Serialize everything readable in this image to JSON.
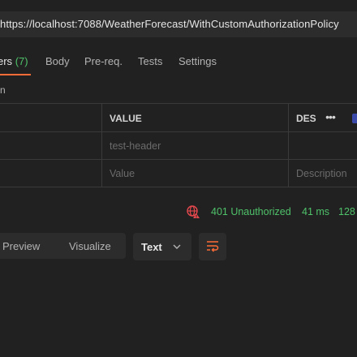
{
  "request": {
    "url": "https://localhost:7088/WeatherForecast/WithCustomAuthorizationPolicy"
  },
  "tabs": [
    {
      "label": "ers",
      "count": "(7)",
      "active": true
    },
    {
      "label": "Body"
    },
    {
      "label": "Pre-req."
    },
    {
      "label": "Tests"
    },
    {
      "label": "Settings"
    }
  ],
  "sub_label": "n",
  "headers_table": {
    "columns": {
      "value": "VALUE",
      "description": "DES"
    },
    "rows": [
      {
        "value": "test-header",
        "description": ""
      },
      {
        "value": "Value",
        "description": "Description"
      }
    ],
    "more_icon": "more-horizontal-icon"
  },
  "response_status": {
    "icon": "globe-error-icon",
    "code": "401 Unauthorized",
    "time": "41 ms",
    "size": "128"
  },
  "response_view": {
    "modes": [
      "Preview",
      "Visualize"
    ],
    "format": "Text",
    "format_icon": "chevron-down-icon",
    "wrap_icon": "wrap-lines-icon"
  },
  "colors": {
    "accent": "#ff6c37",
    "success": "#4fc26a",
    "error": "#e5484d",
    "background": "#212121",
    "surface": "#2c2c2c"
  }
}
